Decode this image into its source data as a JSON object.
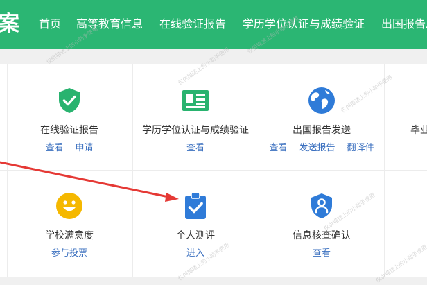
{
  "header": {
    "brand": "案",
    "nav": [
      "首页",
      "高等教育信息",
      "在线验证报告",
      "学历学位认证与成绩验证",
      "出国报告发"
    ]
  },
  "cards": [
    {
      "title": "在线验证报告",
      "links": [
        "查看",
        "申请"
      ],
      "icon": "shield-check-icon"
    },
    {
      "title": "学历学位认证与成绩验证",
      "links": [
        "查看"
      ],
      "icon": "certificate-card-icon"
    },
    {
      "title": "出国报告发送",
      "links": [
        "查看",
        "发送报告",
        "翻译件"
      ],
      "icon": "globe-icon"
    },
    {
      "title": "毕业",
      "links": [],
      "icon": ""
    },
    {
      "title": "学校满意度",
      "links": [
        "参与投票"
      ],
      "icon": "smiley-icon"
    },
    {
      "title": "个人测评",
      "links": [
        "进入"
      ],
      "icon": "clipboard-check-icon"
    },
    {
      "title": "信息核查确认",
      "links": [
        "查看"
      ],
      "icon": "user-shield-icon"
    }
  ],
  "watermark": "仅供描述上的小助手使用",
  "colors": {
    "brand_green": "#2bb673",
    "link_blue": "#3a6fbf",
    "icon_blue": "#2f7bd8",
    "icon_green": "#29b36f",
    "icon_yellow": "#f5b800",
    "arrow_red": "#e53935"
  }
}
